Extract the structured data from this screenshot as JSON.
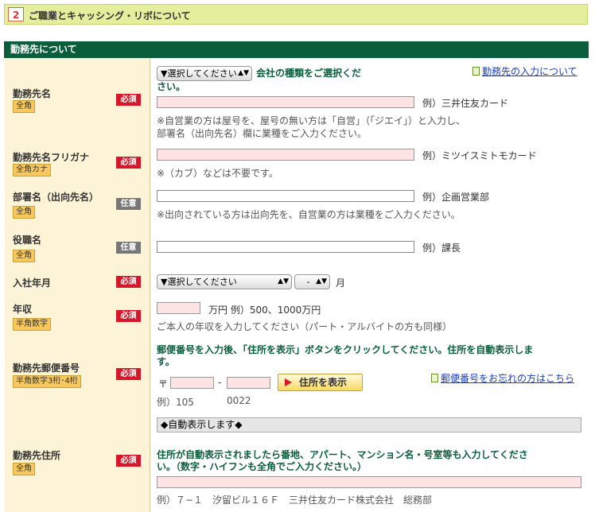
{
  "section": {
    "number": "2",
    "title": "ご職業とキャッシング・リボについて"
  },
  "form_header": "勤務先について",
  "rows": {
    "company": {
      "label": "勤務先名",
      "tag": "全角",
      "badge": "必須",
      "type_select": "▼選択してください",
      "select_prompt_1": "会社の種類をご選択くだ",
      "select_prompt_2": "さい。",
      "help_link": "勤務先の入力について",
      "example": "例）三井住友カード",
      "note_1": "※自営業の方は屋号を、屋号の無い方は「自営」（「ジエイ」）と入力し、",
      "note_2": "部署名（出向先名）欄に業種をご入力ください。"
    },
    "company_kana": {
      "label": "勤務先名フリガナ",
      "tag": "全角カナ",
      "badge": "必須",
      "example": "例）ミツイスミトモカード",
      "note": "※（カブ）などは不要です。"
    },
    "department": {
      "label": "部署名（出向先名）",
      "tag": "全角",
      "badge": "任意",
      "example": "例）企画営業部",
      "note": "※出向されている方は出向先を、自営業の方は業種をご入力ください。"
    },
    "position": {
      "label": "役職名",
      "tag": "全角",
      "badge": "任意",
      "example": "例）課長"
    },
    "join_date": {
      "label": "入社年月",
      "badge": "必須",
      "year_select": "▼選択してください",
      "month_select": "-",
      "month_unit": "月"
    },
    "income": {
      "label": "年収",
      "tag": "半角数字",
      "badge": "必須",
      "unit_example": "万円 例）500、1000万円",
      "note": "ご本人の年収を入力してください（パート・アルバイトの方も同様）"
    },
    "postal": {
      "label": "勤務先郵便番号",
      "tag": "半角数字3桁･4桁",
      "badge": "必須",
      "instruction_1": "郵便番号を入力後、「住所を表示」ボタンをクリックしてください。住所を自動表示しま",
      "instruction_2": "す。",
      "postal_mark": "〒",
      "dash": "-",
      "button": "住所を表示",
      "help_link": "郵便番号をお忘れの方はこちら",
      "example_1": "例）105",
      "example_2": "0022"
    },
    "address": {
      "label": "勤務先住所",
      "tag": "全角",
      "badge": "必須",
      "auto_display": "◆自動表示します◆",
      "instruction_1": "住所が自動表示されましたら番地、アパート、マンション名・号室等も入力してくださ",
      "instruction_2": "い。（数字・ハイフンも全角でご入力ください。）",
      "example": "例）７−１　汐留ビル１６Ｆ　三井住友カード株式会社　総務部"
    }
  },
  "colors": {
    "header_green": "#0b5e3c",
    "required_red": "#d8162a",
    "label_bg": "#fdf3d6",
    "input_pink": "#fde3e4",
    "section_bg": "#e4ef9d"
  }
}
